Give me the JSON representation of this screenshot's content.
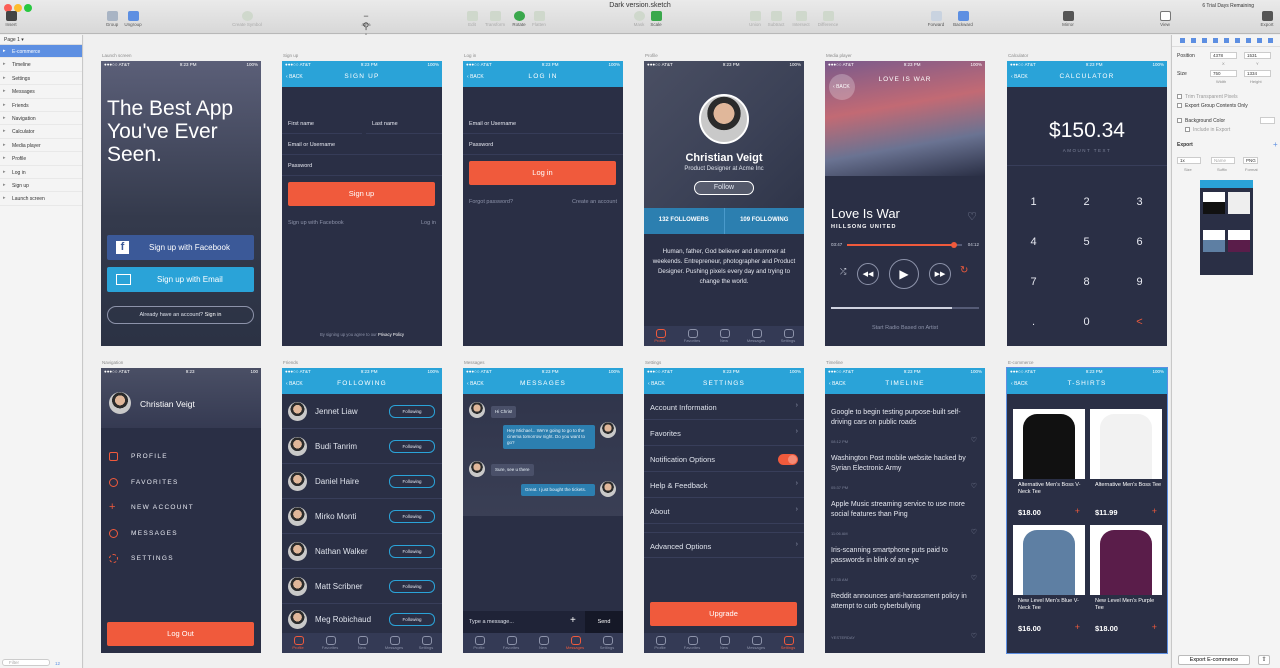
{
  "window": {
    "title": "Dark version.sketch",
    "trial": "6 Trial Days Remaining"
  },
  "toolbar": {
    "items": [
      "Insert",
      "Group",
      "Ungroup",
      "Create Symbol",
      "43%",
      "Edit",
      "Transform",
      "Rotate",
      "Flatten",
      "Mask",
      "Scale",
      "Union",
      "Subtract",
      "Intersect",
      "Difference",
      "Forward",
      "Backward",
      "Mirror",
      "View",
      "Export"
    ]
  },
  "layers": {
    "page": "Page 1",
    "items": [
      "E-commerce",
      "Timeline",
      "Settings",
      "Messages",
      "Friends",
      "Navigation",
      "Calculator",
      "Media player",
      "Profile",
      "Log in",
      "Sign up",
      "Launch screen"
    ],
    "filter": "Filter",
    "count": "12"
  },
  "inspector": {
    "position": "Position",
    "x": "4378",
    "y": "1531",
    "x_lbl": "X",
    "y_lbl": "Y",
    "size": "Size",
    "w": "750",
    "h": "1334",
    "w_lbl": "Width",
    "h_lbl": "Height",
    "trim": "Trim Transparent Pixels",
    "export_group": "Export Group Contents Only",
    "bg_color": "Background Color",
    "include": "Include in Export",
    "export": "Export",
    "scale": "1x",
    "suffix": "Name",
    "format": "PNG",
    "size_l": "Size",
    "suffix_l": "Suffix",
    "format_l": "Format",
    "export_btn": "Export E-commerce"
  },
  "status": {
    "carrier": "●●●○○ AT&T",
    "time": "9:23 PM",
    "battery": "100%"
  },
  "artboards": {
    "launch": {
      "label": "Launch screen",
      "headline": "The Best App You've Ever Seen.",
      "fb": "Sign up with Facebook",
      "email": "Sign up with Email",
      "already": "Already have an account?",
      "signin": "Sign in"
    },
    "signup": {
      "label": "Sign up",
      "back": "BACK",
      "title": "SIGN UP",
      "first": "First name",
      "last": "Last name",
      "email": "Email or Username",
      "password": "Password",
      "btn": "Sign up",
      "fb": "Sign up with Facebook",
      "login": "Log in",
      "terms": "By signing up you agree to our",
      "privacy": "Privacy Policy"
    },
    "login": {
      "label": "Log in",
      "back": "BACK",
      "title": "LOG IN",
      "email": "Email or Username",
      "password": "Password",
      "btn": "Log in",
      "forgot": "Forgot password?",
      "create": "Create an account"
    },
    "profile": {
      "label": "Profile",
      "name": "Christian Veigt",
      "role": "Product Designer at Acme Inc",
      "follow": "Follow",
      "followers": "132 FOLLOWERS",
      "following": "109 FOLLOWING",
      "bio": "Human, father, God believer and drummer at weekends. Entrepreneur, photographer and Product Designer. Pushing pixels every day and trying to change the world."
    },
    "media": {
      "label": "Media player",
      "back": "BACK",
      "title": "LOVE IS WAR",
      "song": "Love Is War",
      "artist": "HILLSONG UNITED",
      "elapsed": "03:47",
      "total": "04:12",
      "radio": "Start Radio Based on Artist"
    },
    "calculator": {
      "label": "Calculator",
      "back": "BACK",
      "title": "CALCULATOR",
      "amount": "$150.34",
      "amount_lbl": "AMOUNT TEXT",
      "keys": [
        "1",
        "2",
        "3",
        "4",
        "5",
        "6",
        "7",
        "8",
        "9",
        ".",
        "0",
        "<"
      ]
    },
    "navigation": {
      "label": "Navigation",
      "time": "9:23",
      "battery": "100",
      "name": "Christian Veigt",
      "items": [
        "PROFILE",
        "FAVORITES",
        "NEW ACCOUNT",
        "MESSAGES",
        "SETTINGS"
      ],
      "logout": "Log Out"
    },
    "friends": {
      "label": "Friends",
      "back": "BACK",
      "title": "FOLLOWING",
      "people": [
        "Jennet Liaw",
        "Budi Tanrim",
        "Daniel Haire",
        "Mirko Monti",
        "Nathan Walker",
        "Matt Scribner",
        "Meg Robichaud"
      ],
      "btn": "Following"
    },
    "messages": {
      "label": "Messages",
      "back": "BACK",
      "title": "MESSAGES",
      "m1": "Hi Chris!",
      "m2": "Hey Michael... We're going to go to the cinema tomorrow night. Do you want to go?",
      "m3": "Sure, see u there",
      "m4": "Great. I just bought the tickets.",
      "placeholder": "Type a message...",
      "send": "Send"
    },
    "settings": {
      "label": "Settings",
      "back": "BACK",
      "title": "SETTINGS",
      "items": [
        "Account Information",
        "Favorites",
        "Notification Options",
        "Help & Feedback",
        "About",
        "Advanced Options"
      ],
      "btn": "Upgrade"
    },
    "timeline": {
      "label": "Timeline",
      "back": "BACK",
      "title": "TIMELINE",
      "news": [
        {
          "t": "Google to begin testing purpose-built self-driving cars on public roads",
          "ts": "08:12 PM"
        },
        {
          "t": "Washington Post mobile website hacked by Syrian Electronic Army",
          "ts": "05:37 PM"
        },
        {
          "t": "Apple Music streaming service to use more social features than Ping",
          "ts": "11:06 AM"
        },
        {
          "t": "Iris-scanning smartphone puts paid to passwords in blink of an eye",
          "ts": "07:35 AM"
        },
        {
          "t": "Reddit announces anti-harassment policy in attempt to curb cyberbullying",
          "ts": "YESTERDAY"
        }
      ]
    },
    "ecommerce": {
      "label": "E-commerce",
      "back": "BACK",
      "title": "T-SHIRTS",
      "products": [
        {
          "name": "Alternative Men's Boss V-Neck Tee",
          "price": "$18.00",
          "color": "#111111"
        },
        {
          "name": "Alternative Men's Boss Tee",
          "price": "$11.99",
          "color": "#f2f2f2"
        },
        {
          "name": "New Level Men's Blue V-Neck Tee",
          "price": "$16.00",
          "color": "#5e7fa3"
        },
        {
          "name": "New Level Men's Purple Tee",
          "price": "$18.00",
          "color": "#5a1d4a"
        }
      ]
    }
  },
  "tabs": [
    "Profile",
    "Favorites",
    "New",
    "Messages",
    "Settings"
  ],
  "colors": {
    "accent": "#f05a3c",
    "blue": "#2aa3d8",
    "bg": "#2a2f45",
    "facebook": "#3b5998",
    "email": "#2aa3d8"
  }
}
